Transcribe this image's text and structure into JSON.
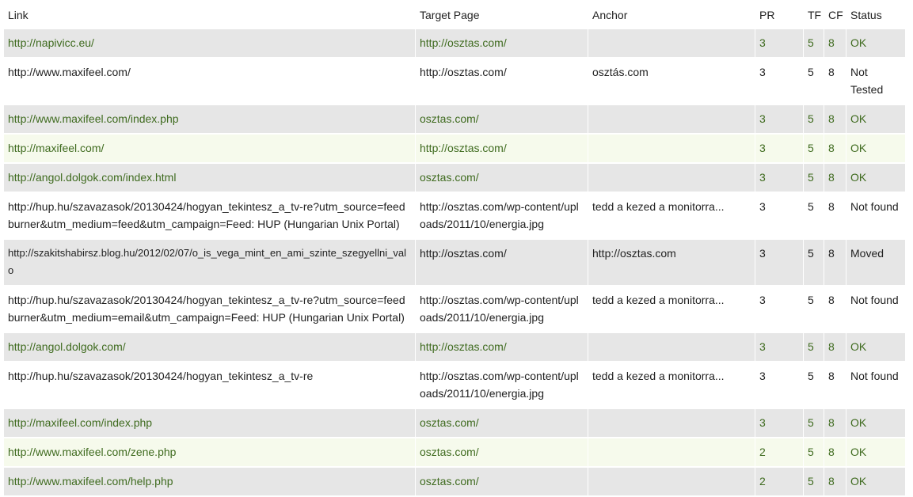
{
  "table": {
    "headers": {
      "link": "Link",
      "target": "Target Page",
      "anchor": "Anchor",
      "pr": "PR",
      "tf": "TF",
      "cf": "CF",
      "status": "Status"
    },
    "rows": [
      {
        "link": "http://napivicc.eu/",
        "target": "http://osztas.com/",
        "anchor": "",
        "pr": "3",
        "tf": "5",
        "cf": "8",
        "status": "OK"
      },
      {
        "link": "http://www.maxifeel.com/",
        "target": "http://osztas.com/",
        "anchor": "osztás.com",
        "pr": "3",
        "tf": "5",
        "cf": "8",
        "status": "Not Tested"
      },
      {
        "link": "http://www.maxifeel.com/index.php",
        "target": "osztas.com/",
        "anchor": "",
        "pr": "3",
        "tf": "5",
        "cf": "8",
        "status": "OK"
      },
      {
        "link": "http://maxifeel.com/",
        "target": "http://osztas.com/",
        "anchor": "",
        "pr": "3",
        "tf": "5",
        "cf": "8",
        "status": "OK"
      },
      {
        "link": "http://angol.dolgok.com/index.html",
        "target": "osztas.com/",
        "anchor": "",
        "pr": "3",
        "tf": "5",
        "cf": "8",
        "status": "OK"
      },
      {
        "link": "http://hup.hu/szavazasok/20130424/hogyan_tekintesz_a_tv-re?utm_source=feedburner&utm_medium=feed&utm_campaign=Feed: HUP (Hungarian Unix Portal)",
        "target": "http://osztas.com/wp-content/uploads/2011/10/energia.jpg",
        "anchor": "tedd a kezed a monitorra...",
        "pr": "3",
        "tf": "5",
        "cf": "8",
        "status": "Not found"
      },
      {
        "link": "http://szakitshabirsz.blog.hu/2012/02/07/o_is_vega_mint_en_ami_szinte_szegyellni_valo",
        "target": "http://osztas.com/",
        "anchor": "http://osztas.com",
        "pr": "3",
        "tf": "5",
        "cf": "8",
        "status": "Moved"
      },
      {
        "link": "http://hup.hu/szavazasok/20130424/hogyan_tekintesz_a_tv-re?utm_source=feedburner&utm_medium=email&utm_campaign=Feed: HUP (Hungarian Unix Portal)",
        "target": "http://osztas.com/wp-content/uploads/2011/10/energia.jpg",
        "anchor": "tedd a kezed a monitorra...",
        "pr": "3",
        "tf": "5",
        "cf": "8",
        "status": "Not found"
      },
      {
        "link": "http://angol.dolgok.com/",
        "target": "http://osztas.com/",
        "anchor": "",
        "pr": "3",
        "tf": "5",
        "cf": "8",
        "status": "OK"
      },
      {
        "link": "http://hup.hu/szavazasok/20130424/hogyan_tekintesz_a_tv-re",
        "target": "http://osztas.com/wp-content/uploads/2011/10/energia.jpg",
        "anchor": "tedd a kezed a monitorra...",
        "pr": "3",
        "tf": "5",
        "cf": "8",
        "status": "Not found"
      },
      {
        "link": "http://maxifeel.com/index.php",
        "target": "osztas.com/",
        "anchor": "",
        "pr": "3",
        "tf": "5",
        "cf": "8",
        "status": "OK"
      },
      {
        "link": "http://www.maxifeel.com/zene.php",
        "target": "osztas.com/",
        "anchor": "",
        "pr": "2",
        "tf": "5",
        "cf": "8",
        "status": "OK"
      },
      {
        "link": "http://www.maxifeel.com/help.php",
        "target": "osztas.com/",
        "anchor": "",
        "pr": "2",
        "tf": "5",
        "cf": "8",
        "status": "OK"
      }
    ]
  },
  "colors": {
    "ok_text": "#3f6b1f",
    "row_gray": "#e6e6e6",
    "row_green": "#f6faec"
  }
}
